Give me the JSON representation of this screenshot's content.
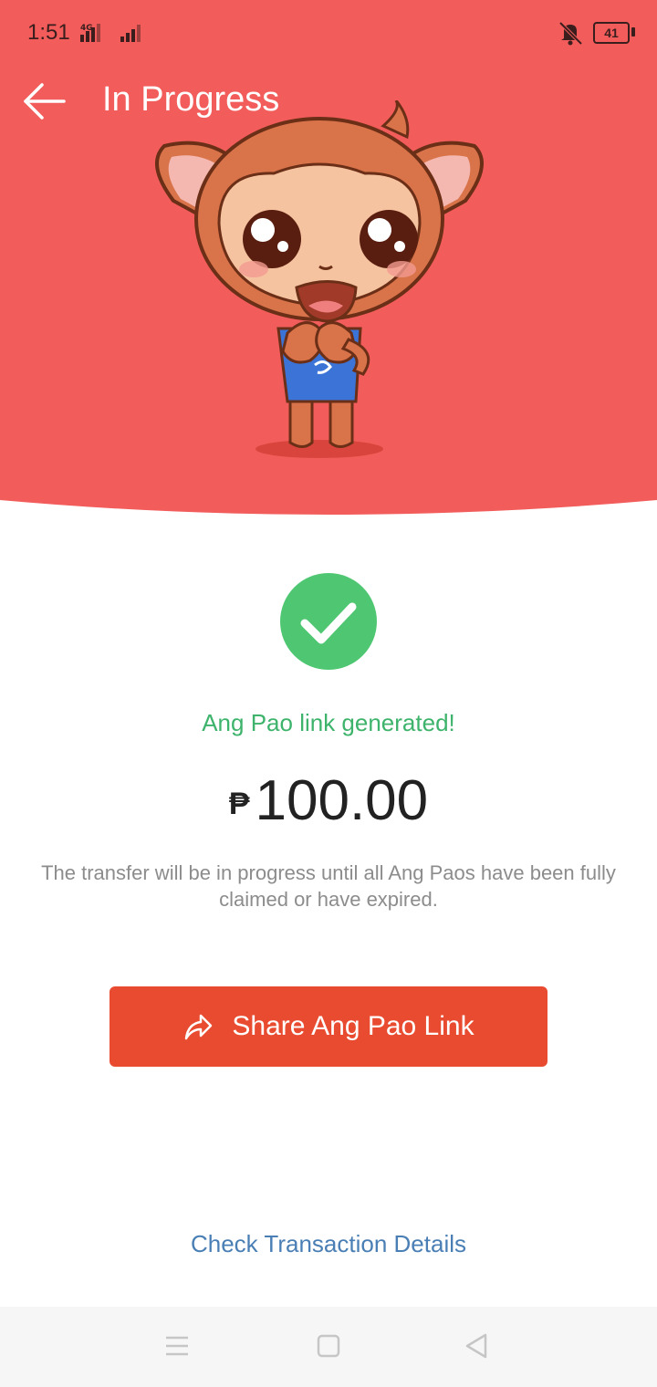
{
  "status_bar": {
    "time": "1:51",
    "network": "4G",
    "battery": "41"
  },
  "header": {
    "title": "In Progress",
    "back_icon": "arrow-left-icon",
    "background_color": "#f25d5b"
  },
  "result": {
    "success_icon": "check-circle-icon",
    "message": "Ang Pao link generated!",
    "currency_symbol": "₱",
    "amount": "100.00",
    "description": "The transfer will be in progress until all Ang Paos have been fully claimed or have expired."
  },
  "actions": {
    "share_label": "Share Ang Pao Link",
    "share_icon": "share-arrow-icon",
    "share_color": "#e94b30",
    "details_link": "Check Transaction Details"
  },
  "navbar": {
    "icons": [
      "menu-icon",
      "home-square-icon",
      "back-triangle-icon"
    ]
  }
}
